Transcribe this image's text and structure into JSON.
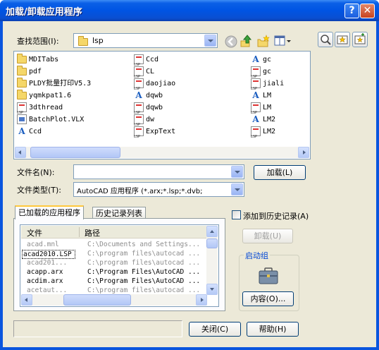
{
  "window": {
    "title": "加载/卸载应用程序"
  },
  "titlebar": {
    "help_label": "?",
    "close_label": "✕"
  },
  "lookin": {
    "label": "查找范围(I):",
    "value": "lsp"
  },
  "files": [
    {
      "icon": "folder-icon",
      "name": "MDITabs"
    },
    {
      "icon": "folder-icon",
      "name": "pdf"
    },
    {
      "icon": "folder-icon",
      "name": "PLDY批量打印V5.3"
    },
    {
      "icon": "folder-icon",
      "name": "yqmkpat1.6"
    },
    {
      "icon": "lsp-icon",
      "name": "3dthread"
    },
    {
      "icon": "vlx-icon",
      "name": "BatchPlot.VLX"
    },
    {
      "icon": "autocad-icon",
      "name": "Ccd"
    },
    {
      "icon": "lsp-icon",
      "name": "Ccd"
    },
    {
      "icon": "lsp-icon",
      "name": "CL"
    },
    {
      "icon": "lsp-icon",
      "name": "daojiao"
    },
    {
      "icon": "autocad-icon",
      "name": "dqwb"
    },
    {
      "icon": "lsp-icon",
      "name": "dqwb"
    },
    {
      "icon": "lsp-icon",
      "name": "dw"
    },
    {
      "icon": "lsp-icon",
      "name": "ExpText"
    },
    {
      "icon": "autocad-icon",
      "name": "gc"
    },
    {
      "icon": "lsp-icon",
      "name": "gc"
    },
    {
      "icon": "lsp-icon",
      "name": "jiali"
    },
    {
      "icon": "autocad-icon",
      "name": "LM"
    },
    {
      "icon": "lsp-icon",
      "name": "LM"
    },
    {
      "icon": "autocad-icon",
      "name": "LM2"
    },
    {
      "icon": "lsp-icon",
      "name": "LM2"
    }
  ],
  "filename": {
    "label": "文件名(N):",
    "value": ""
  },
  "filetype": {
    "label": "文件类型(T):",
    "value": "AutoCAD 应用程序 (*.arx;*.lsp;*.dvb;"
  },
  "buttons": {
    "load": "加载(L)",
    "unload": "卸载(U)",
    "contents": "内容(O)...",
    "close": "关闭(C)",
    "help": "帮助(H)"
  },
  "tabs": [
    {
      "label": "已加载的应用程序"
    },
    {
      "label": "历史记录列表"
    }
  ],
  "add_history": {
    "label": "添加到历史记录(A)"
  },
  "startup_group": {
    "label": "启动组"
  },
  "loaded_table": {
    "columns": [
      "文件",
      "路径"
    ],
    "rows": [
      {
        "file": "acad.mnl",
        "path": "C:\\Documents and Settings...",
        "dim": true
      },
      {
        "file": "acad2010.LSP",
        "path": "C:\\program files\\autocad ...",
        "dim": true
      },
      {
        "file": "acad201...",
        "path": "C:\\program files\\autocad ...",
        "dim": true
      },
      {
        "file": "acapp.arx",
        "path": "C:\\Program Files\\AutoCAD ...",
        "dim": false
      },
      {
        "file": "acdim.arx",
        "path": "C:\\Program Files\\AutoCAD ...",
        "dim": false
      },
      {
        "file": "acetaut...",
        "path": "C:\\program files\\autocad ...",
        "dim": true
      }
    ]
  }
}
